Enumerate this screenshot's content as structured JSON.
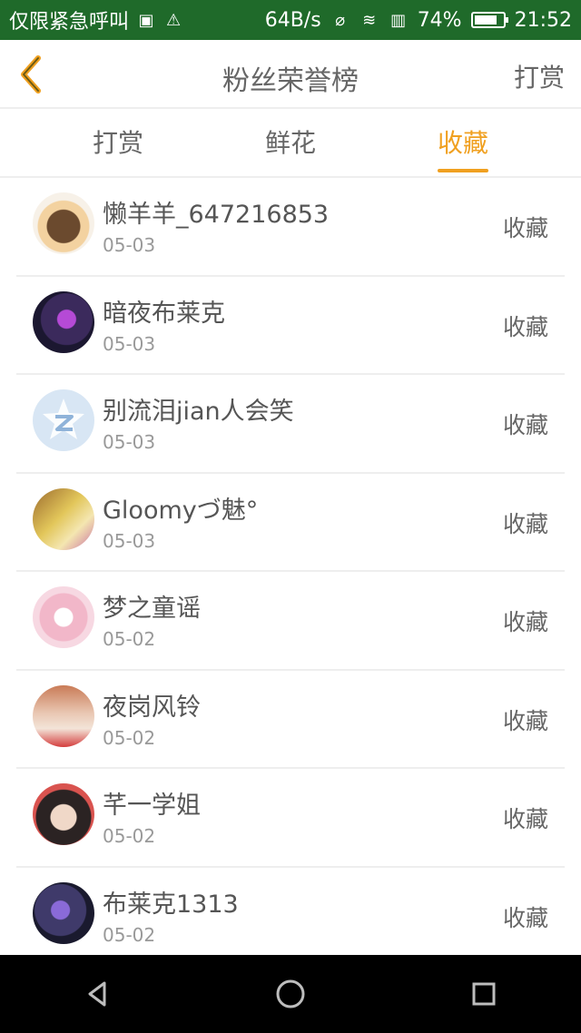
{
  "status_bar": {
    "carrier": "仅限紧急呼叫",
    "network_speed": "64B/s",
    "battery_percent": "74%",
    "time": "21:52",
    "icons": [
      "image-icon",
      "warning-icon",
      "mute-icon",
      "wifi-icon",
      "sim-icon",
      "battery-icon"
    ]
  },
  "header": {
    "title": "粉丝荣誉榜",
    "right_action": "打赏",
    "back_icon": "chevron-left-icon",
    "accent_color": "#f0a020"
  },
  "tabs": [
    {
      "label": "打赏",
      "active": false
    },
    {
      "label": "鲜花",
      "active": false
    },
    {
      "label": "收藏",
      "active": true
    }
  ],
  "list": [
    {
      "name": "懒羊羊_647216853",
      "date": "05-03",
      "action": "收藏",
      "avatar_color": "#f3d2a0"
    },
    {
      "name": "暗夜布莱克",
      "date": "05-03",
      "action": "收藏",
      "avatar_color": "#3b2a5c"
    },
    {
      "name": "别流泪jian人会笑",
      "date": "05-03",
      "action": "收藏",
      "avatar_color": "#d8e6f4"
    },
    {
      "name": "Gloomyづ魅°",
      "date": "05-03",
      "action": "收藏",
      "avatar_color": "#e2c65a"
    },
    {
      "name": "梦之童谣",
      "date": "05-02",
      "action": "收藏",
      "avatar_color": "#f2b7c9"
    },
    {
      "name": "夜岗风铃",
      "date": "05-02",
      "action": "收藏",
      "avatar_color": "#e9c7b3"
    },
    {
      "name": "芊一学姐",
      "date": "05-02",
      "action": "收藏",
      "avatar_color": "#7b6a6a"
    },
    {
      "name": "布莱克1313",
      "date": "05-02",
      "action": "收藏",
      "avatar_color": "#3f3a6a"
    }
  ],
  "nav": {
    "back": "nav-back-icon",
    "home": "nav-home-icon",
    "recent": "nav-recent-icon"
  }
}
